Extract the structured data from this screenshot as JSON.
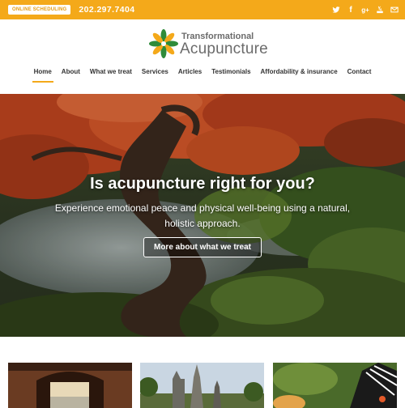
{
  "topbar": {
    "online_label": "ONLINE SCHEDULING",
    "phone": "202.297.7404",
    "social_icons": [
      "twitter-icon",
      "facebook-icon",
      "google-plus-icon",
      "youtube-icon",
      "email-icon"
    ],
    "background": "#f4a91a"
  },
  "logo": {
    "line1": "Transformational",
    "line2": "Acupuncture"
  },
  "nav": {
    "items": [
      {
        "label": "Home",
        "active": true
      },
      {
        "label": "About"
      },
      {
        "label": "What we treat"
      },
      {
        "label": "Services"
      },
      {
        "label": "Articles"
      },
      {
        "label": "Testimonials"
      },
      {
        "label": "Affordability & insurance"
      },
      {
        "label": "Contact"
      }
    ],
    "accent": "#f4a91a"
  },
  "hero": {
    "title": "Is acupuncture right for you?",
    "subtitle": "Experience emotional peace and physical well-being using a natural, holistic approach.",
    "button_label": "More about what we treat"
  },
  "cards": [
    "archway-image",
    "temple-image",
    "butterfly-image"
  ]
}
